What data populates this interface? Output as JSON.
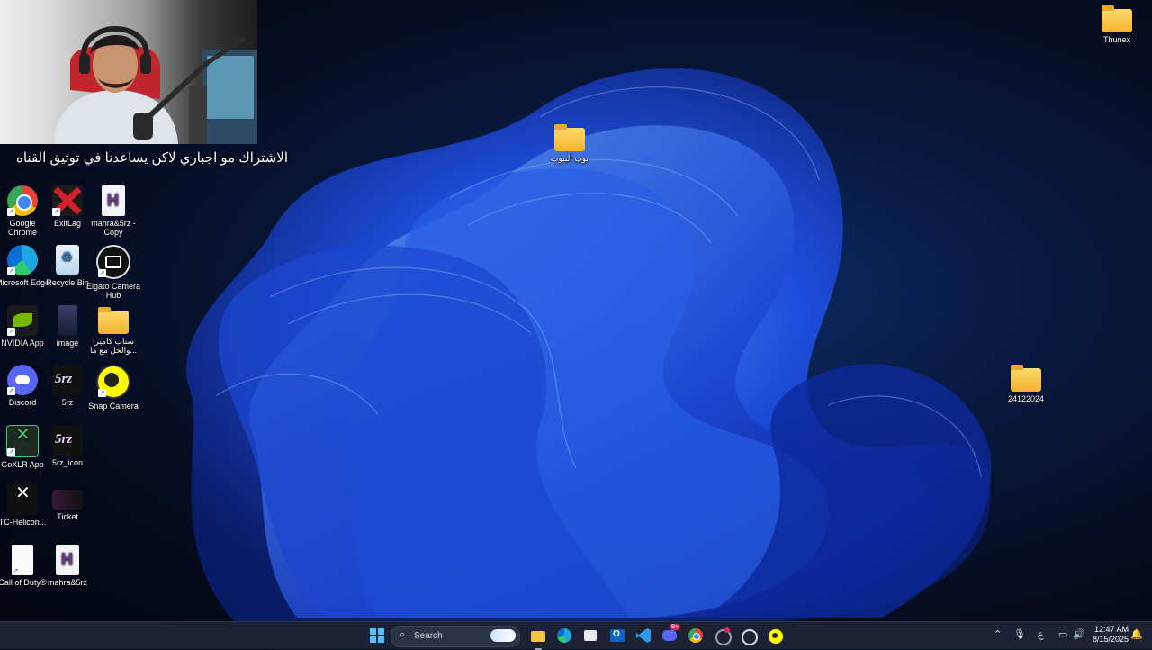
{
  "desktop": {
    "center_folder_label": "توب النيوب",
    "right_icons": [
      {
        "label": "Thunex",
        "icon": "folder-icon"
      },
      {
        "label": "24122024",
        "icon": "folder-icon"
      }
    ],
    "icons": [
      {
        "label": "Google Chrome",
        "icon": "chrome-icon"
      },
      {
        "label": "ExitLag",
        "icon": "exitlag-icon"
      },
      {
        "label": "mahra&5rz - Copy",
        "icon": "document-h-icon"
      },
      {
        "label": "Microsoft Edge",
        "icon": "edge-icon"
      },
      {
        "label": "Recycle Bin",
        "icon": "recycle-bin-icon"
      },
      {
        "label": "Elgato Camera Hub",
        "icon": "camera-icon"
      },
      {
        "label": "NVIDIA App",
        "icon": "nvidia-icon"
      },
      {
        "label": "image",
        "icon": "image-icon"
      },
      {
        "label": "سناب كاميرا والحل مع ما...",
        "icon": "folder-icon"
      },
      {
        "label": "Discord",
        "icon": "discord-icon"
      },
      {
        "label": "5rz",
        "icon": "logo-icon"
      },
      {
        "label": "Snap Camera",
        "icon": "snap-camera-icon"
      },
      {
        "label": "GoXLR App",
        "icon": "goxlr-icon"
      },
      {
        "label": "5rz_icon",
        "icon": "logo-icon"
      },
      {
        "label": "TC-Helicon...",
        "icon": "tc-helicon-icon"
      },
      {
        "label": "Ticket",
        "icon": "ticket-icon"
      },
      {
        "label": "Call of Duty®",
        "icon": "blank-document-icon"
      },
      {
        "label": "mahra&5rz",
        "icon": "document-h-icon"
      }
    ]
  },
  "overlay": {
    "caption": "الاشتراك مو اجباري لاكن يساعدنا في توثيق القناه"
  },
  "taskbar": {
    "search_label": "Search",
    "pinned": [
      "windows-start-icon",
      "file-explorer-icon",
      "edge-icon",
      "store-icon",
      "outlook-icon",
      "vscode-icon",
      "discord-icon",
      "chrome-icon",
      "app-icon",
      "camera-hub-icon",
      "snap-camera-icon"
    ],
    "discord_badge": "9+",
    "tray": {
      "language": "ع",
      "time": "12:47 AM",
      "date": "8/15/2025"
    }
  },
  "colors": {
    "taskbar_bg": "#1c2233",
    "wallpaper_blue": "#1f4fe0",
    "folder_yellow": "#f3b32e"
  }
}
